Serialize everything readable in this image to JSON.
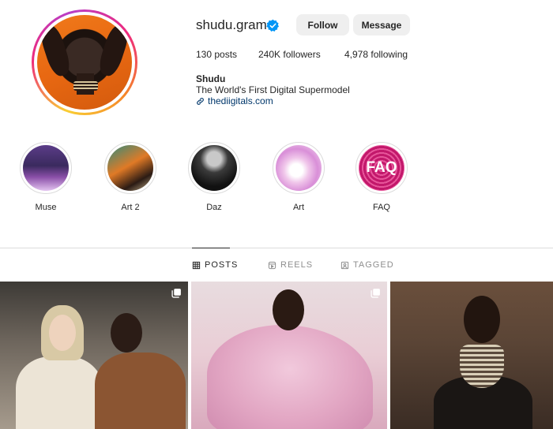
{
  "profile": {
    "username": "shudu.gram",
    "follow_label": "Follow",
    "message_label": "Message",
    "stats": {
      "posts": "130 posts",
      "followers": "240K followers",
      "following": "4,978 following"
    },
    "bio": {
      "name": "Shudu",
      "description": "The World's First Digital Supermodel",
      "link": "thediigitals.com"
    }
  },
  "highlights": [
    {
      "label": "Muse"
    },
    {
      "label": "Art 2"
    },
    {
      "label": "Daz"
    },
    {
      "label": "Art"
    },
    {
      "label": "FAQ",
      "cover_text": "FAQ"
    }
  ],
  "tabs": [
    {
      "label": "POSTS",
      "active": true,
      "icon": "grid-icon"
    },
    {
      "label": "REELS",
      "active": false,
      "icon": "reels-icon"
    },
    {
      "label": "TAGGED",
      "active": false,
      "icon": "tagged-icon"
    }
  ],
  "colors": {
    "verified": "#0095f6",
    "link": "#00376b",
    "button_bg": "#efefef"
  }
}
